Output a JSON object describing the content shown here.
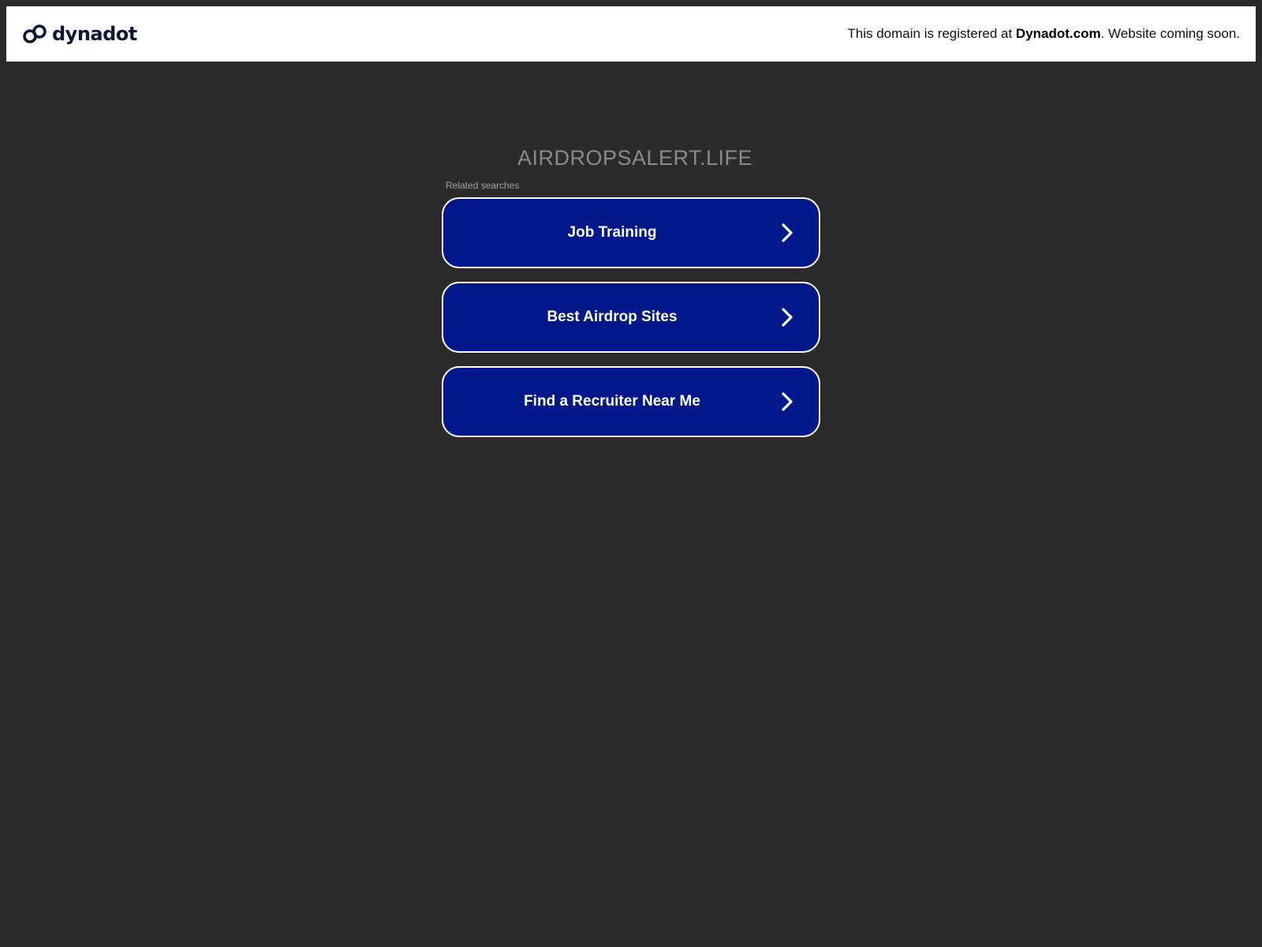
{
  "header": {
    "brand_name": "dynadot",
    "brand_icon": "chain-link-icon",
    "notice_prefix": "This domain is registered at ",
    "notice_link": "Dynadot.com",
    "notice_suffix": ". Website coming soon."
  },
  "main": {
    "domain_title": "AIRDROPSALERT.LIFE",
    "related_label": "Related searches",
    "links": [
      {
        "label": "Job Training",
        "icon": "chevron-right-icon"
      },
      {
        "label": "Best Airdrop Sites",
        "icon": "chevron-right-icon"
      },
      {
        "label": "Find a Recruiter Near Me",
        "icon": "chevron-right-icon"
      }
    ]
  },
  "colors": {
    "page_background": "#2b2b2b",
    "header_background": "#ffffff",
    "button_background": "#03198b",
    "button_border": "#ffffff",
    "brand_text": "#0c1639"
  }
}
